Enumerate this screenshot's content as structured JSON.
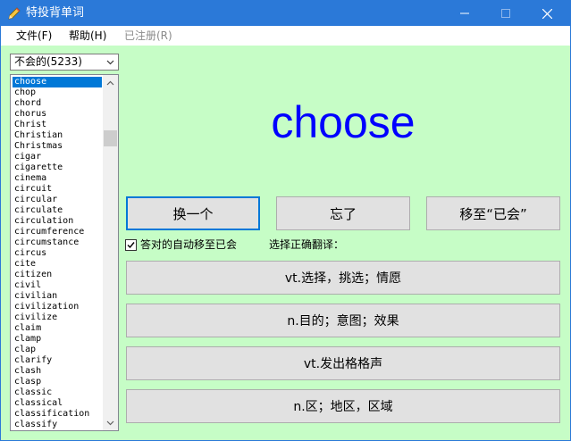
{
  "window": {
    "title": "特投背单词",
    "colors": {
      "titlebar": "#2b79d8",
      "background": "#c6fdc6",
      "word": "#0000ff",
      "selection": "#0078d7"
    }
  },
  "menu": {
    "file": "文件(F)",
    "help": "帮助(H)",
    "registered": "已注册(R)"
  },
  "filter": {
    "selected": "不会的(5233)"
  },
  "word_list": [
    "choose",
    "chop",
    "chord",
    "chorus",
    "Christ",
    "Christian",
    "Christmas",
    "cigar",
    "cigarette",
    "cinema",
    "circuit",
    "circular",
    "circulate",
    "circulation",
    "circumference",
    "circumstance",
    "circus",
    "cite",
    "citizen",
    "civil",
    "civilian",
    "civilization",
    "civilize",
    "claim",
    "clamp",
    "clap",
    "clarify",
    "clash",
    "clasp",
    "classic",
    "classical",
    "classification",
    "classify"
  ],
  "current_word": "choose",
  "buttons": {
    "next": "换一个",
    "forget": "忘了",
    "move_known": "移至“已会”"
  },
  "auto_move": {
    "label": "答对的自动移至已会",
    "checked": true
  },
  "prompt": "选择正确翻译：",
  "options": [
    "vt.选择，挑选；情愿",
    "n.目的；意图；效果",
    "vt.发出格格声",
    "n.区；地区，区域"
  ]
}
